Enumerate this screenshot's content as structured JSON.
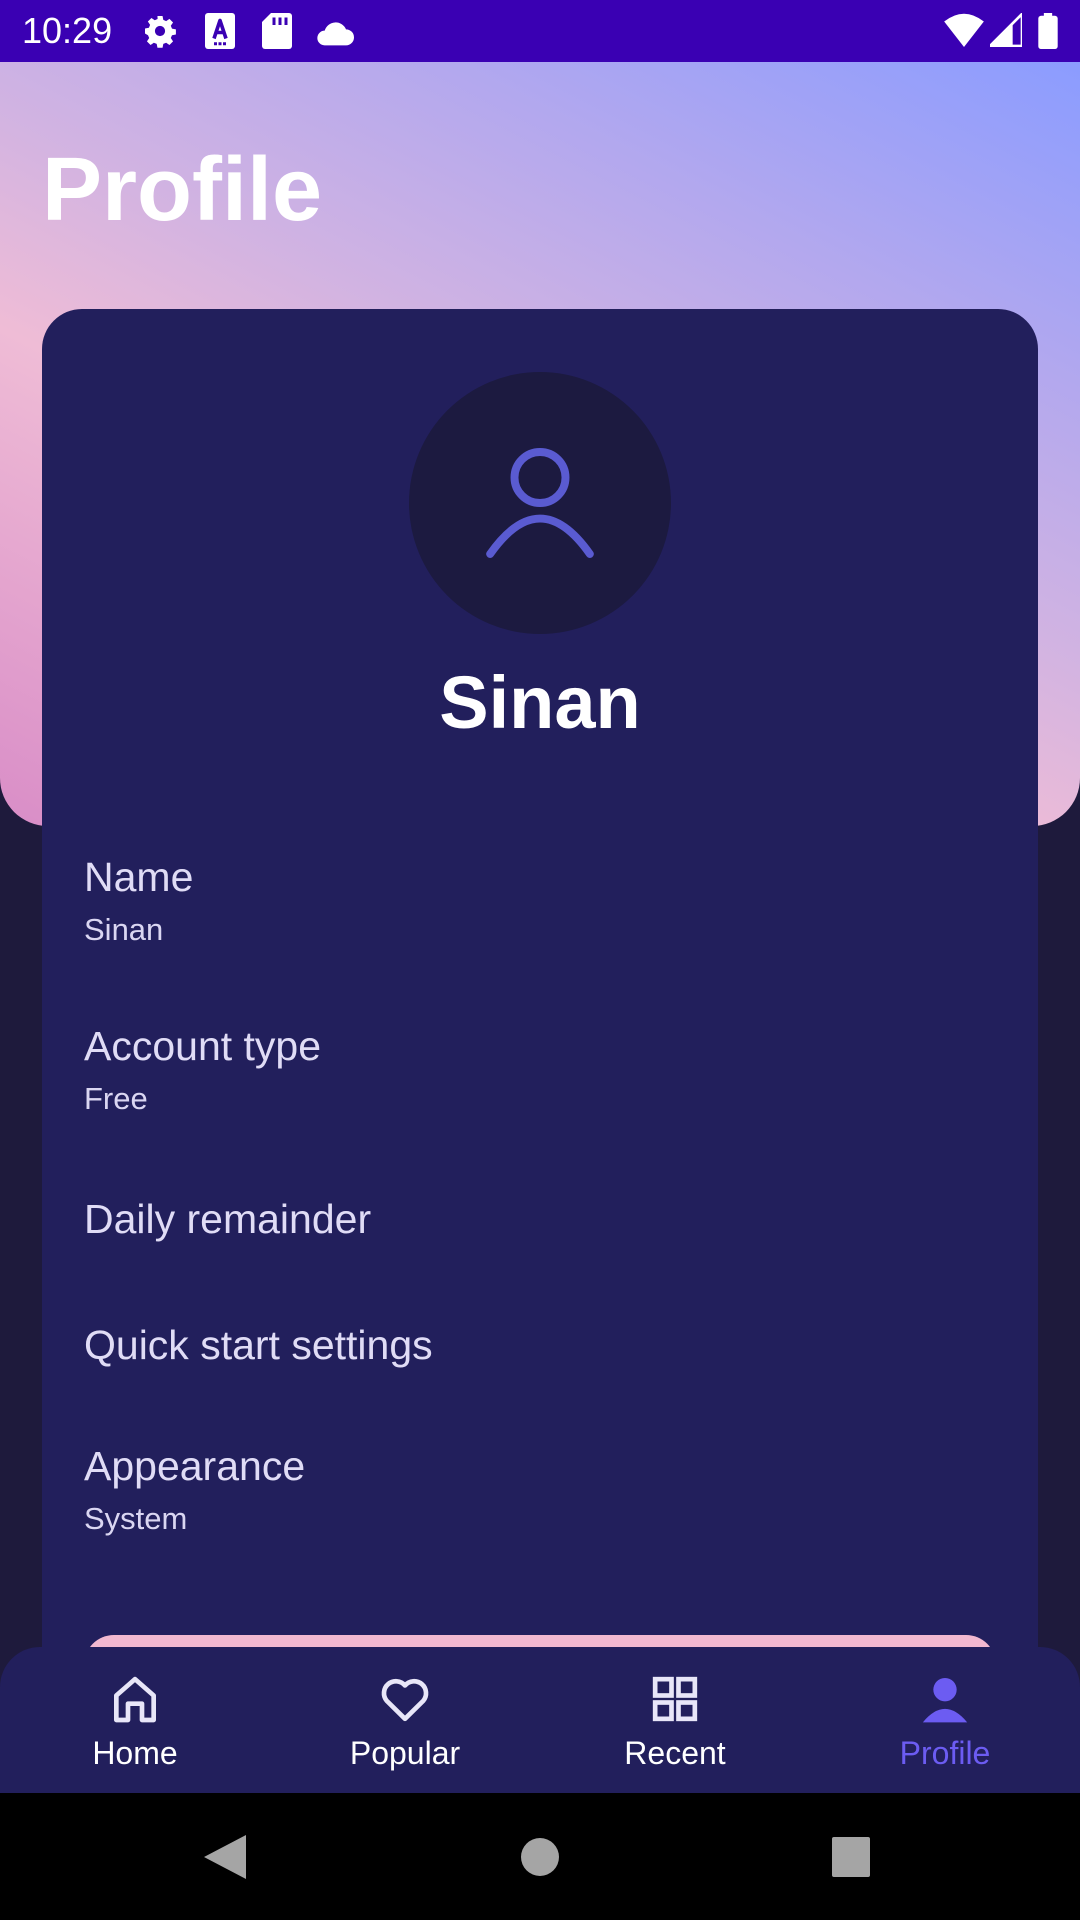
{
  "status_bar": {
    "time": "10:29",
    "left_icons": [
      "gear-icon",
      "keyboard-a-icon",
      "sd-card-icon",
      "cloud-icon"
    ],
    "right_icons": [
      "wifi-icon",
      "signal-icon",
      "battery-icon"
    ]
  },
  "header": {
    "title": "Profile"
  },
  "profile": {
    "avatar_icon": "person-outline-icon",
    "name": "Sinan"
  },
  "settings": [
    {
      "title": "Name",
      "value": "Sinan"
    },
    {
      "title": "Account type",
      "value": "Free"
    },
    {
      "title": "Daily remainder"
    },
    {
      "title": "Quick start settings"
    },
    {
      "title": "Appearance",
      "value": "System"
    }
  ],
  "bottom_nav": {
    "items": [
      {
        "label": "Home",
        "icon": "home-icon"
      },
      {
        "label": "Popular",
        "icon": "heart-icon"
      },
      {
        "label": "Recent",
        "icon": "grid-icon"
      },
      {
        "label": "Profile",
        "icon": "person-icon",
        "active": true
      }
    ]
  },
  "system_nav": {
    "icons": [
      "back-icon",
      "home-circle-icon",
      "recents-icon"
    ]
  },
  "colors": {
    "status_bar": "#3a00b3",
    "card": "#221f5c",
    "page_background": "#1e1a3c",
    "accent": "#6c5cf2",
    "avatar_icon": "#5a5bd1",
    "logout_button": "#f2b8d0"
  }
}
